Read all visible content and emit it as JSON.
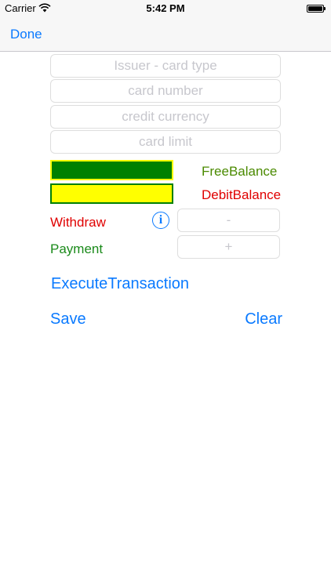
{
  "status_bar": {
    "carrier": "Carrier",
    "time": "5:42 PM",
    "icons": [
      "wifi-icon",
      "battery-icon"
    ]
  },
  "nav": {
    "done_label": "Done"
  },
  "form": {
    "issuer_placeholder": "Issuer - card type",
    "card_number_placeholder": "card number",
    "currency_placeholder": "credit currency",
    "limit_placeholder": "card limit"
  },
  "balances": {
    "free_label": "FreeBalance",
    "debit_label": "DebitBalance",
    "free_color": "#008000",
    "debit_color": "#ffff00"
  },
  "transactions": {
    "withdraw_label": "Withdraw",
    "payment_label": "Payment",
    "withdraw_placeholder": "-",
    "payment_placeholder": "+",
    "info_icon": "info-icon",
    "info_glyph": "i"
  },
  "actions": {
    "execute_label": "ExecuteTransaction",
    "save_label": "Save",
    "clear_label": "Clear"
  },
  "colors": {
    "accent": "#0a7aff",
    "withdraw": "#e00000",
    "payment": "#1a8a1a"
  }
}
